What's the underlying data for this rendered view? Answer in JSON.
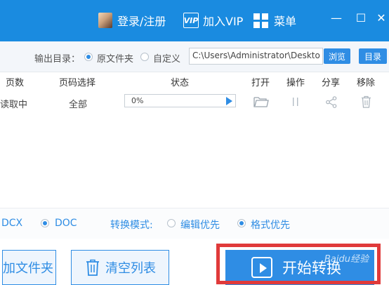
{
  "titlebar": {
    "login_label": "登录/注册",
    "vip_badge": "VIP",
    "vip_label": "加入VIP",
    "menu_label": "菜单",
    "minimize_glyph": "—",
    "maximize_glyph": "☐",
    "close_glyph": "✕",
    "bg_color": "#1a8be0"
  },
  "output": {
    "label": "输出目录：",
    "options": [
      "原文件夹",
      "自定义"
    ],
    "selected": "原文件夹",
    "path_value": "C:\\Users\\Administrator\\Deskto",
    "browse_label": "浏览",
    "dir_label": "目录"
  },
  "table": {
    "headers": [
      "页数",
      "页码选择",
      "状态",
      "打开",
      "操作",
      "分享",
      "移除"
    ],
    "rows": [
      {
        "pages": "读取中",
        "page_select": "全部",
        "progress_text": "0%",
        "progress": 0
      }
    ],
    "icons": [
      "folder-icon",
      "pause-icon",
      "share-icon",
      "trash-icon"
    ]
  },
  "format": {
    "options": [
      "DOCX",
      "DOC"
    ],
    "visible_docx": "DCX",
    "selected": "DOC",
    "mode_label": "转换模式:",
    "modes": [
      "编辑优先",
      "格式优先"
    ],
    "selected_mode": "格式优先"
  },
  "buttons": {
    "add_folder": "加文件夹",
    "clear_list": "清空列表",
    "start": "开始转换"
  },
  "watermark": "Baidu经验",
  "accent_color": "#2f8de4",
  "highlight_color": "#e03a3a"
}
